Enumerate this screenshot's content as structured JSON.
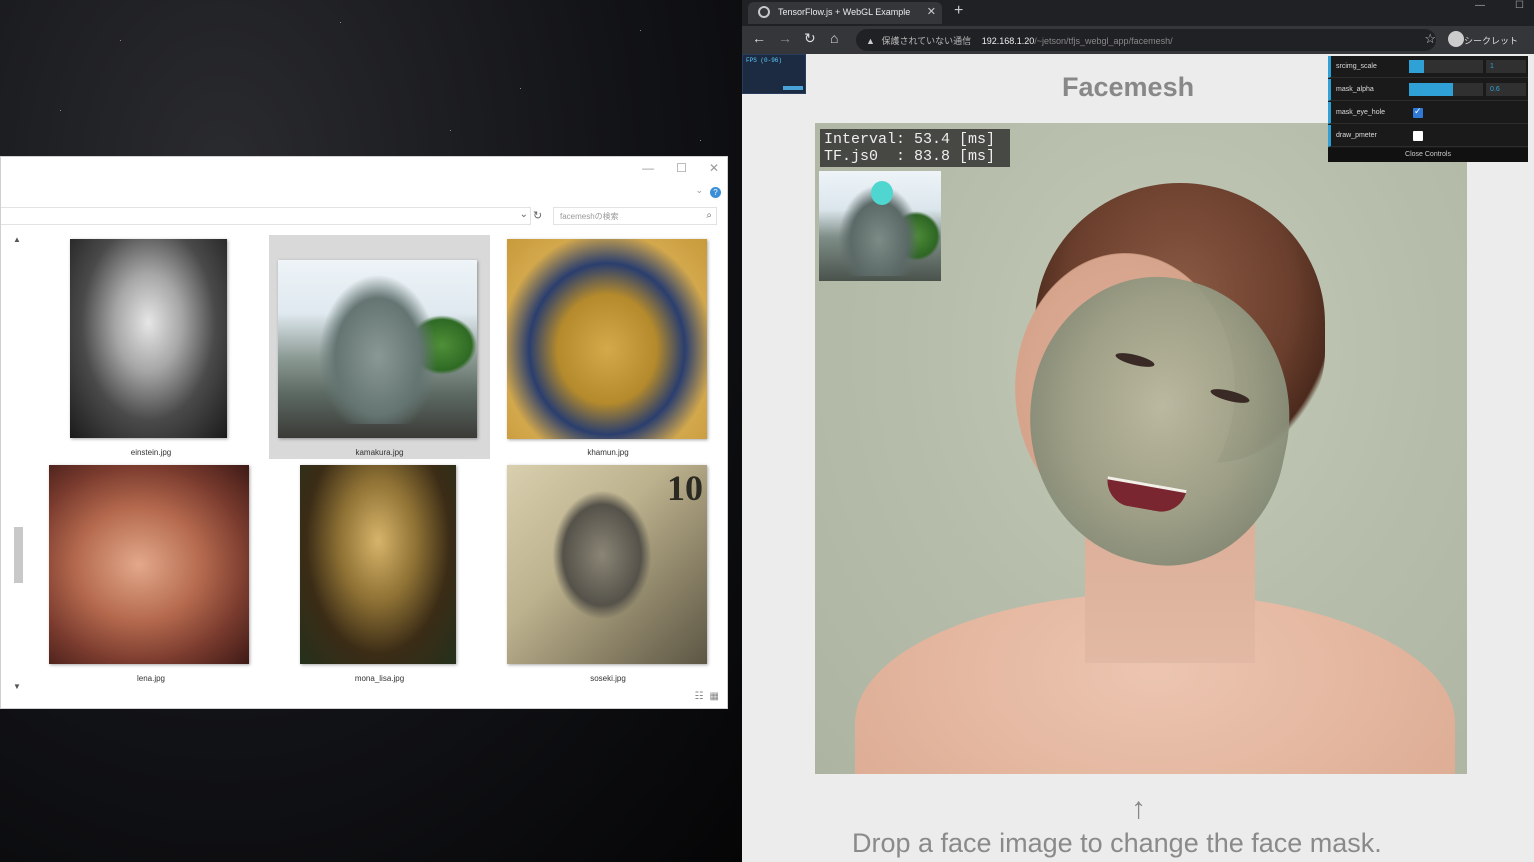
{
  "explorer": {
    "search_placeholder": "facemeshの検索",
    "files": [
      {
        "name": "einstein.jpg"
      },
      {
        "name": "kamakura.jpg"
      },
      {
        "name": "khamun.jpg"
      },
      {
        "name": "lena.jpg"
      },
      {
        "name": "mona_lisa.jpg"
      },
      {
        "name": "soseki.jpg"
      }
    ],
    "banknote_label": "10"
  },
  "browser": {
    "tab_title": "TensorFlow.js + WebGL Example",
    "address_warning": "保護されていない通信",
    "address_host": "192.168.1.20",
    "address_path": "/~jetson/tfjs_webgl_app/facemesh/",
    "profile_label": "シークレット"
  },
  "page": {
    "title": "Facemesh",
    "stats_widget_label": "FPS (0-96)",
    "interval_line": "Interval: 53.4 [ms]",
    "tfjs_line": "TF.js0  : 83.8 [ms]",
    "drop_arrow": "↑",
    "drop_message": "Drop a face image to change the face mask."
  },
  "controls": {
    "srcimg_scale": {
      "label": "srcimg_scale",
      "value": "1",
      "level": 0.2
    },
    "mask_alpha": {
      "label": "mask_alpha",
      "value": "0.6",
      "level": 0.6
    },
    "mask_eye_hole": {
      "label": "mask_eye_hole",
      "checked": true
    },
    "draw_pmeter": {
      "label": "draw_pmeter",
      "checked": false
    },
    "close_label": "Close Controls"
  },
  "colors": {
    "gui_accent": "#2fa1d6",
    "face_marker": "#4fd6d0"
  }
}
